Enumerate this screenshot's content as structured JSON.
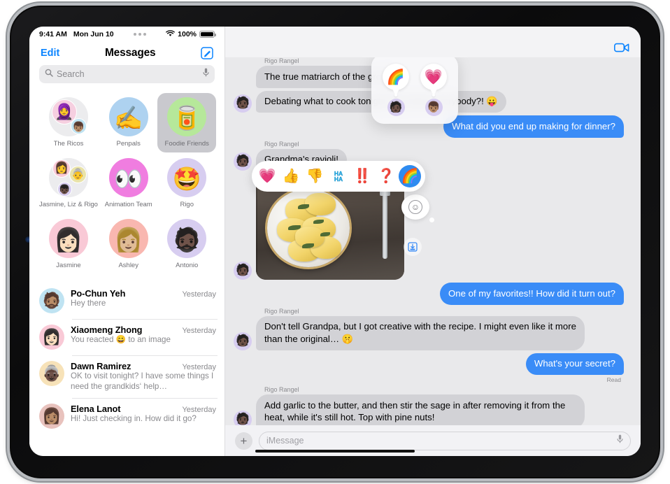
{
  "status_bar": {
    "time": "9:41 AM",
    "date": "Mon Jun 10",
    "battery_percent": "100%",
    "wifi_icon": "wifi-icon",
    "battery_icon": "battery-icon",
    "multitask_icon": "multitasking-dots-icon"
  },
  "sidebar": {
    "edit_label": "Edit",
    "title": "Messages",
    "compose_icon": "compose-icon",
    "search": {
      "placeholder": "Search",
      "search_icon": "search-icon",
      "mic_icon": "microphone-icon"
    },
    "pinned": [
      {
        "label": "The Ricos",
        "emoji": "🧕",
        "emoji2": "👦🏽",
        "type": "group",
        "bg": "#ececee",
        "selected": false
      },
      {
        "label": "Penpals",
        "emoji": "✍️",
        "type": "single",
        "bg": "#aed2f0",
        "selected": false
      },
      {
        "label": "Foodie Friends",
        "emoji": "🥫",
        "type": "single",
        "bg": "#b6e89a",
        "selected": true
      },
      {
        "label": "Jasmine, Liz & Rigo",
        "emoji": "👩",
        "emoji2": "👵",
        "emoji3": "👦🏿",
        "type": "group3",
        "bg": "#ececee",
        "selected": false
      },
      {
        "label": "Animation Team",
        "emoji": "👀",
        "type": "single",
        "bg": "#f07de0",
        "selected": false
      },
      {
        "label": "Rigo",
        "emoji": "🤩",
        "type": "single",
        "bg": "#d7cdf0",
        "selected": false
      },
      {
        "label": "Jasmine",
        "emoji": "👩🏻",
        "type": "single",
        "bg": "#f9c9d6",
        "selected": false
      },
      {
        "label": "Ashley",
        "emoji": "👩🏼",
        "type": "single",
        "bg": "#f9b7b0",
        "selected": false
      },
      {
        "label": "Antonio",
        "emoji": "🧔🏿",
        "type": "single",
        "bg": "#d7cdf0",
        "selected": false
      }
    ],
    "conversations": [
      {
        "name": "Po-Chun Yeh",
        "time": "Yesterday",
        "preview": "Hey there",
        "emoji": "🧔🏽",
        "bg": "#bfe3f2"
      },
      {
        "name": "Xiaomeng Zhong",
        "time": "Yesterday",
        "preview": "You reacted 😄 to an image",
        "emoji": "👩🏻",
        "bg": "#f9c9d6"
      },
      {
        "name": "Dawn Ramirez",
        "time": "Yesterday",
        "preview": "OK to visit tonight? I have some things I need the grandkids‘ help…",
        "emoji": "👵🏿",
        "bg": "#f7e2b8"
      },
      {
        "name": "Elena Lanot",
        "time": "Yesterday",
        "preview": "Hi! Just checking in. How did it go?",
        "emoji": "👩🏽",
        "bg": "#e8c2bd"
      }
    ]
  },
  "thread": {
    "facetime_icon": "facetime-video-icon",
    "sender_label": "Rigo Rangel",
    "messages": [
      {
        "id": "m1",
        "dir": "in",
        "sender": "Rigo Rangel",
        "text": "The true matriarch of the group."
      },
      {
        "id": "m2",
        "dir": "in",
        "sender": "",
        "text": "Debating what to cook tonight. Any ideas everybody?! 😛"
      },
      {
        "id": "m3",
        "dir": "out",
        "sender": "",
        "text": "What did you end up making for dinner?"
      },
      {
        "id": "m4",
        "dir": "in",
        "sender": "Rigo Rangel",
        "text": "Grandma's ravioli!"
      },
      {
        "id": "m5",
        "dir": "in",
        "sender": "",
        "type": "photo",
        "text": "",
        "alt": "Plate of ravioli with sage on a wooden table"
      },
      {
        "id": "m6",
        "dir": "out",
        "sender": "",
        "text": "One of my favorites!! How did it turn out?"
      },
      {
        "id": "m7",
        "dir": "in",
        "sender": "Rigo Rangel",
        "text": "Don't tell Grandpa, but I got creative with the recipe. I might even like it more than the original… 🤫"
      },
      {
        "id": "m8",
        "dir": "out",
        "sender": "",
        "text": "What's your secret?",
        "receipt": "Read"
      },
      {
        "id": "m9",
        "dir": "in",
        "sender": "Rigo Rangel",
        "text": "Add garlic to the butter, and then stir the sage in after removing it from the heat, while it's still hot. Top with pine nuts!"
      }
    ],
    "tapback_picker": {
      "options": [
        {
          "name": "heart-tapback",
          "emoji": "💗",
          "active": false
        },
        {
          "name": "thumbs-up-tapback",
          "emoji": "👍",
          "active": false
        },
        {
          "name": "thumbs-down-tapback",
          "emoji": "👎",
          "active": false
        },
        {
          "name": "haha-tapback",
          "emoji": "🆗",
          "label": "HA HA",
          "active": false
        },
        {
          "name": "exclamation-tapback",
          "emoji": "‼️",
          "active": false
        },
        {
          "name": "question-tapback",
          "emoji": "❓",
          "active": false
        },
        {
          "name": "rainbow-emoji-tapback",
          "emoji": "🌈",
          "active": true
        }
      ]
    },
    "tapback_summary": [
      {
        "emoji": "🌈",
        "avatar": "🧑🏿"
      },
      {
        "emoji": "💗",
        "avatar": "👦🏽"
      }
    ],
    "emoji_sticker_icon": "smiley-face-icon",
    "save_icon": "save-to-photos-icon"
  },
  "composer": {
    "plus_icon": "plus-icon",
    "placeholder": "iMessage",
    "mic_icon": "microphone-icon"
  }
}
